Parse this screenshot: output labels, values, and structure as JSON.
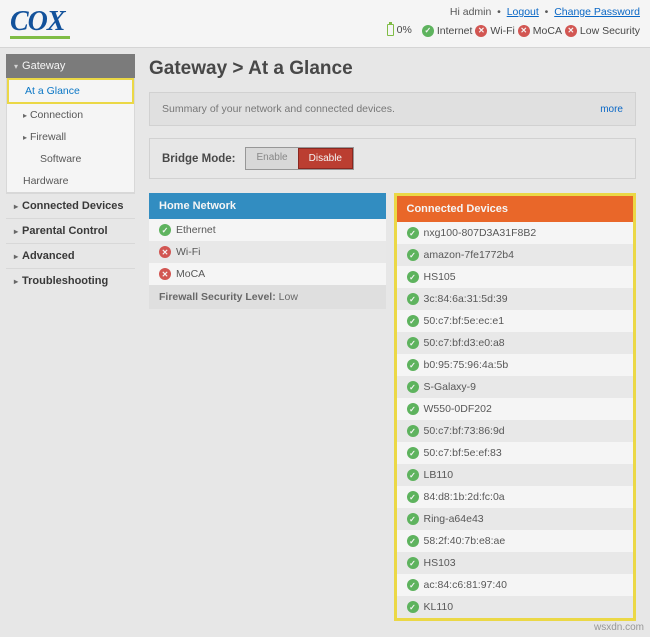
{
  "header": {
    "logo_text": "COX",
    "greeting": "Hi admin",
    "logout": "Logout",
    "change_pw": "Change Password",
    "battery_pct": "0%",
    "status": [
      {
        "state": "ok",
        "label": "Internet"
      },
      {
        "state": "err",
        "label": "Wi-Fi"
      },
      {
        "state": "err",
        "label": "MoCA"
      },
      {
        "state": "err",
        "label": "Low Security"
      }
    ]
  },
  "sidebar": {
    "gateway": {
      "label": "Gateway",
      "expanded": true
    },
    "items": [
      {
        "label": "At a Glance",
        "active": true
      },
      {
        "label": "Connection"
      },
      {
        "label": "Firewall"
      },
      {
        "label": "Software"
      },
      {
        "label": "Hardware"
      }
    ],
    "top_items": [
      {
        "label": "Connected Devices"
      },
      {
        "label": "Parental Control"
      },
      {
        "label": "Advanced"
      },
      {
        "label": "Troubleshooting"
      }
    ]
  },
  "page": {
    "title": "Gateway > At a Glance",
    "summary": "Summary of your network and connected devices.",
    "more": "more",
    "bridge_label": "Bridge Mode:",
    "enable": "Enable",
    "disable": "Disable"
  },
  "home_network": {
    "title": "Home Network",
    "rows": [
      {
        "state": "ok",
        "label": "Ethernet"
      },
      {
        "state": "err",
        "label": "Wi-Fi"
      },
      {
        "state": "err",
        "label": "MoCA"
      }
    ],
    "firewall_label": "Firewall Security Level:",
    "firewall_value": "Low"
  },
  "connected_devices": {
    "title": "Connected Devices",
    "rows": [
      "nxg100-807D3A31F8B2",
      "amazon-7fe1772b4",
      "HS105",
      "3c:84:6a:31:5d:39",
      "50:c7:bf:5e:ec:e1",
      "50:c7:bf:d3:e0:a8",
      "b0:95:75:96:4a:5b",
      "S-Galaxy-9",
      "W550-0DF202",
      "50:c7:bf:73:86:9d",
      "50:c7:bf:5e:ef:83",
      "LB110",
      "84:d8:1b:2d:fc:0a",
      "Ring-a64e43",
      "58:2f:40:7b:e8:ae",
      "HS103",
      "ac:84:c6:81:97:40",
      "KL110"
    ]
  },
  "watermark": "wsxdn.com"
}
